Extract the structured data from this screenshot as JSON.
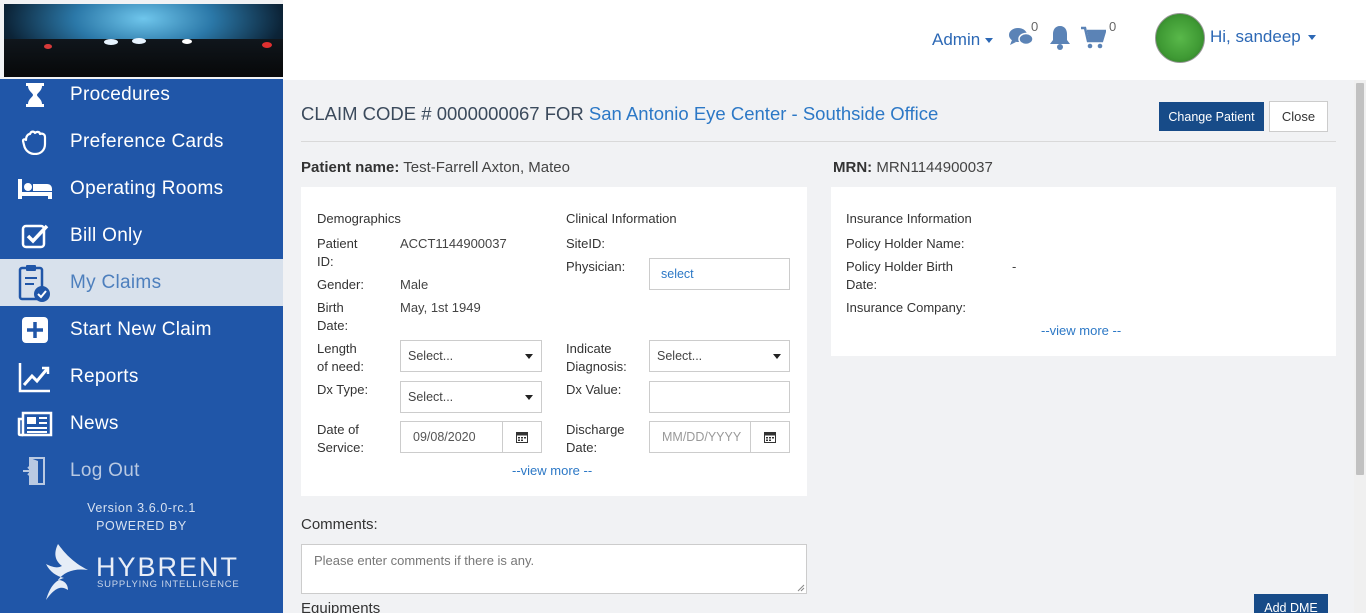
{
  "sidebar": {
    "items": [
      {
        "label": "Procedures",
        "icon": "hourglass-icon"
      },
      {
        "label": "Preference Cards",
        "icon": "glove-icon"
      },
      {
        "label": "Operating Rooms",
        "icon": "bed-icon"
      },
      {
        "label": "Bill Only",
        "icon": "checkbox-icon"
      },
      {
        "label": "My Claims",
        "icon": "clipboard-check-icon",
        "active": true
      },
      {
        "label": "Start New Claim",
        "icon": "plus-square-icon"
      },
      {
        "label": "Reports",
        "icon": "chart-line-icon"
      },
      {
        "label": "News",
        "icon": "newspaper-icon"
      },
      {
        "label": "Log Out",
        "icon": "door-exit-icon"
      }
    ],
    "version": "Version 3.6.0-rc.1",
    "powered_by": "POWERED BY",
    "brand": "HYBRENT",
    "brand_tagline": "SUPPLYING INTELLIGENCE"
  },
  "header": {
    "admin_label": "Admin",
    "messages_count": "0",
    "cart_count": "0",
    "greeting": "Hi, sandeep"
  },
  "claim": {
    "title_prefix": "CLAIM CODE # 0000000067 FOR",
    "facility": "San Antonio Eye Center - Southside Office",
    "change_patient": "Change Patient",
    "close": "Close",
    "patient_name_label": "Patient name:",
    "patient_name": "Test-Farrell Axton, Mateo",
    "mrn_label": "MRN:",
    "mrn": "MRN1144900037"
  },
  "demographics": {
    "heading": "Demographics",
    "patient_id_label_1": "Patient",
    "patient_id_label_2": "ID:",
    "patient_id": "ACCT1144900037",
    "gender_label": "Gender:",
    "gender": "Male",
    "birth_label_1": "Birth",
    "birth_label_2": "Date:",
    "birth_date": "May, 1st 1949",
    "length_label_1": "Length",
    "length_label_2": "of need:",
    "length_value": "Select...",
    "dx_type_label": "Dx Type:",
    "dx_type_value": "Select...",
    "dos_label_1": "Date of",
    "dos_label_2": "Service:",
    "dos_value": "09/08/2020"
  },
  "clinical": {
    "heading": "Clinical Information",
    "site_label": "SiteID:",
    "physician_label": "Physician:",
    "physician_value": "select",
    "diag_label_1": "Indicate",
    "diag_label_2": "Diagnosis:",
    "diag_value": "Select...",
    "dx_value_label": "Dx Value:",
    "dx_value": "",
    "discharge_label_1": "Discharge",
    "discharge_label_2": "Date:",
    "discharge_placeholder": "MM/DD/YYYY",
    "view_more": "--view more --"
  },
  "insurance": {
    "heading": "Insurance Information",
    "holder_name_label": "Policy Holder Name:",
    "holder_birth_label_1": "Policy Holder Birth",
    "holder_birth_label_2": "Date:",
    "holder_birth_value": "-",
    "company_label": "Insurance Company:",
    "view_more": "--view more --"
  },
  "comments": {
    "label": "Comments:",
    "placeholder": "Please enter comments if there is any."
  },
  "equipments": {
    "label": "Equipments",
    "add_dme": "Add DME"
  }
}
